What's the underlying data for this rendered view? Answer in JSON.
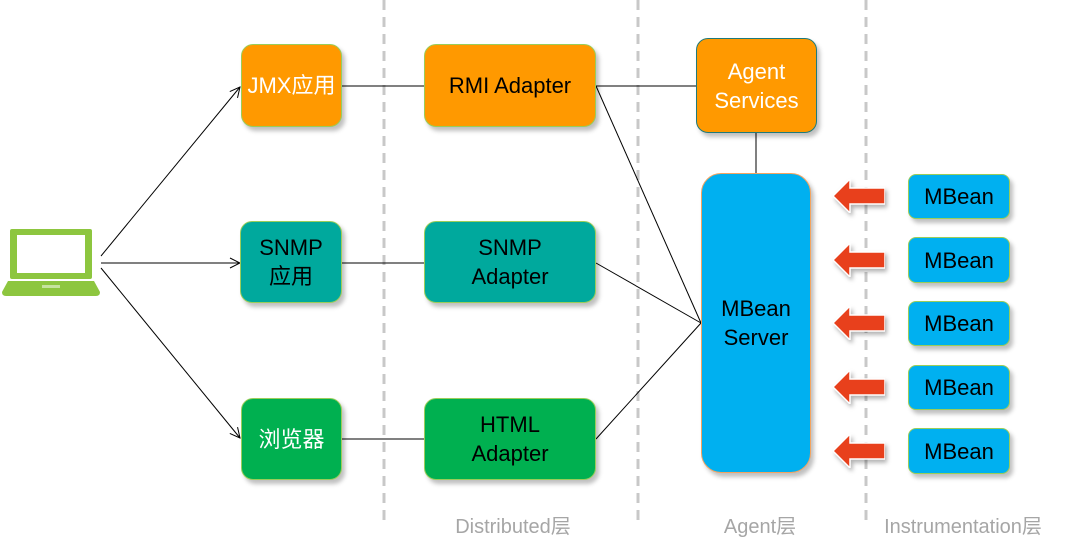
{
  "client": {
    "icon": "laptop-icon",
    "color": "#8dc63f"
  },
  "apps": [
    {
      "label": "JMX应用",
      "color": "#ff9900"
    },
    {
      "label": "SNMP\n应用",
      "color": "#00a99d"
    },
    {
      "label": "浏览器",
      "color": "#00b050"
    }
  ],
  "adapters": [
    {
      "label": "RMI Adapter"
    },
    {
      "label": "SNMP\nAdapter"
    },
    {
      "label": "HTML\nAdapter"
    }
  ],
  "agent_services": {
    "label": "Agent\nServices"
  },
  "mbean_server": {
    "label": "MBean\nServer",
    "color": "#00b0f0"
  },
  "mbeans": [
    {
      "label": "MBean"
    },
    {
      "label": "MBean"
    },
    {
      "label": "MBean"
    },
    {
      "label": "MBean"
    },
    {
      "label": "MBean"
    }
  ],
  "arrow_color": "#e8401c",
  "layers": [
    {
      "label": "Distributed层"
    },
    {
      "label": "Agent层"
    },
    {
      "label": "Instrumentation层"
    }
  ]
}
